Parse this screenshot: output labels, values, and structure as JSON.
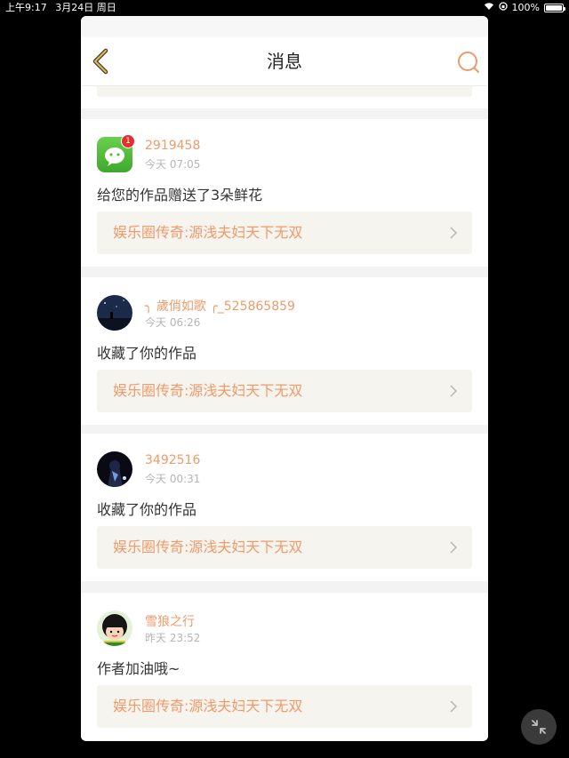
{
  "status_bar": {
    "time": "上午9:17",
    "date": "3月24日 周日",
    "battery": "100%"
  },
  "header": {
    "title": "消息",
    "icons": [
      "back-chevron-icon",
      "search-icon"
    ]
  },
  "colors": {
    "accent": "#ef9a6a",
    "back_icon": "#e6b64a",
    "card_box": "#f6f4ee",
    "wechat_green": "#4cb831"
  },
  "messages": [
    {
      "username": "2919458",
      "time": "今天 07:05",
      "text": "给您的作品赠送了3朵鲜花",
      "work_title": "娱乐圈传奇:源浅夫妇天下无双",
      "avatar": "wechat-app-icon",
      "badge": "1"
    },
    {
      "username": "╮ 歲俏如歌 ╭_525865859",
      "time": "今天 06:26",
      "text": "收藏了你的作品",
      "work_title": "娱乐圈传奇:源浅夫妇天下无双",
      "avatar": "night-scene-avatar"
    },
    {
      "username": "3492516",
      "time": "今天 00:31",
      "text": "收藏了你的作品",
      "work_title": "娱乐圈传奇:源浅夫妇天下无双",
      "avatar": "anime-avatar"
    },
    {
      "username": "雪狼之行",
      "time": "昨天 23:52",
      "text": "作者加油哦~",
      "work_title": "娱乐圈传奇:源浅夫妇天下无双",
      "avatar": "cartoon-girl-avatar"
    }
  ]
}
